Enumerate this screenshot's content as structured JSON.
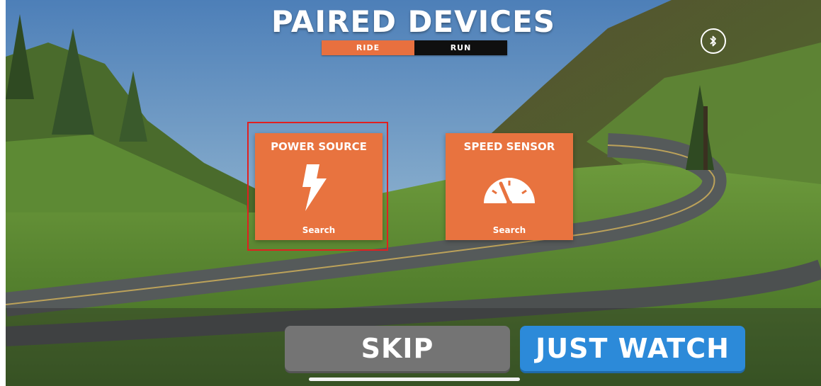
{
  "header": {
    "title": "PAIRED DEVICES"
  },
  "tabs": [
    {
      "label": "RIDE",
      "active": true
    },
    {
      "label": "RUN",
      "active": false
    }
  ],
  "bluetooth": {
    "icon": "bluetooth-icon"
  },
  "devices": [
    {
      "title": "POWER SOURCE",
      "status": "Search",
      "icon": "lightning-bolt-icon",
      "highlighted": true
    },
    {
      "title": "SPEED SENSOR",
      "status": "Search",
      "icon": "speedometer-icon",
      "highlighted": false
    }
  ],
  "actions": {
    "skip_label": "SKIP",
    "watch_label": "JUST WATCH"
  },
  "colors": {
    "accent": "#e8733f",
    "tab_inactive": "#0f0f0f",
    "skip": "#747474",
    "watch": "#2c8ad9",
    "highlight": "#e02020"
  }
}
